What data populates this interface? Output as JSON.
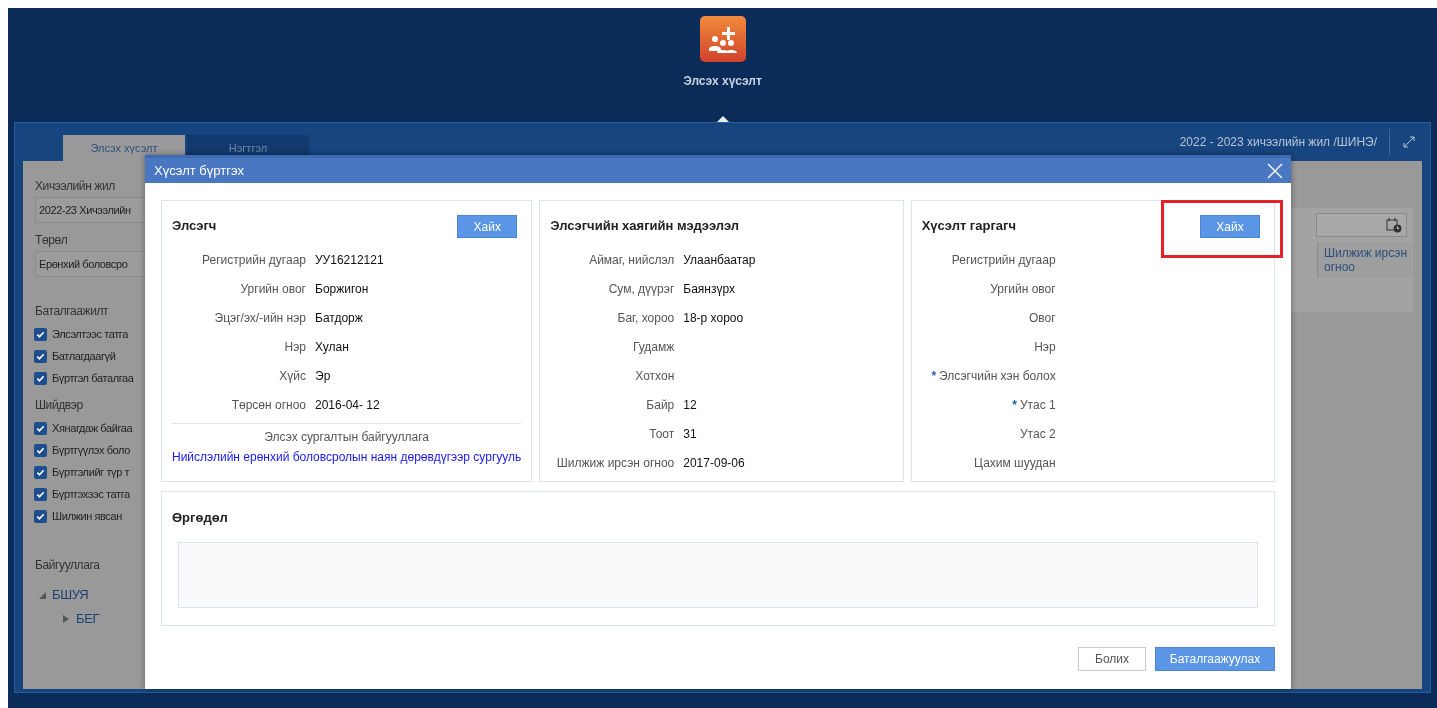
{
  "app": {
    "title": "Элсэх хүсэлт"
  },
  "panel": {
    "tabs": [
      {
        "label": "Элсэх хүсэлт",
        "selected": true
      },
      {
        "label": "Нэгтгэл",
        "selected": false
      }
    ],
    "year": "2022 - 2023 хичээлийн жил /ШИНЭ/"
  },
  "sidebar": {
    "fields": [
      {
        "label": "Хичээлийн жил",
        "value": "2022-23 Хичээлийн"
      },
      {
        "label": "Төрөл",
        "value": "Ерөнхий боловсро"
      }
    ],
    "groups": [
      {
        "title": "Баталгаажилт",
        "items": [
          {
            "label": "Элсэлтээс татга",
            "checked": true
          },
          {
            "label": "Батлагдаагүй",
            "checked": true
          },
          {
            "label": "Бүртгэл баталгаа",
            "checked": true
          }
        ]
      },
      {
        "title": "Шийдвэр",
        "items": [
          {
            "label": "Хянагдаж байгаа",
            "checked": true
          },
          {
            "label": "Бүртгүүлэх боло",
            "checked": true
          },
          {
            "label": "Бүртгэлийг түр т",
            "checked": true
          },
          {
            "label": "Бүртгэхээс татга",
            "checked": true
          },
          {
            "label": "Шилжин явсан",
            "checked": true
          }
        ]
      }
    ],
    "org": {
      "title": "Байгууллага",
      "tree": [
        {
          "label": "БШУЯ",
          "expanded": true,
          "children": [
            {
              "label": "БЕГ",
              "expanded": false
            }
          ]
        }
      ]
    }
  },
  "table": {
    "columns": [
      "Шилжиж ирсэн огноо"
    ]
  },
  "dialog": {
    "title": "Хүсэлт бүртгэх",
    "sections": [
      {
        "title": "Элсэгч",
        "button": {
          "label": "Хайх",
          "highlighted": false
        },
        "rows": [
          {
            "label": "Регистрийн дугаар",
            "value": "УУ16212121"
          },
          {
            "label": "Ургийн овог",
            "value": "Боржигон"
          },
          {
            "label": "Эцэг/эх/-ийн нэр",
            "value": "Батдорж"
          },
          {
            "label": "Нэр",
            "value": "Хулан"
          },
          {
            "label": "Хүйс",
            "value": "Эр"
          },
          {
            "label": "Төрсөн огноо",
            "value": "2016-04- 12"
          }
        ],
        "org_label": "Элсэх сургалтын байгууллага",
        "org_value": "Нийслэлийн ерөнхий боловсролын наян дөрөвдүгээр сургууль"
      },
      {
        "title": "Элсэгчийн хаягийн мэдээлэл",
        "rows": [
          {
            "label": "Аймаг, нийслэл",
            "value": "Улаанбаатар"
          },
          {
            "label": "Сум, дүүрэг",
            "value": "Баянзүрх"
          },
          {
            "label": "Баг, хороо",
            "value": "18-р хороо"
          },
          {
            "label": "Гудамж"
          },
          {
            "label": "Хотхон"
          },
          {
            "label": "Байр",
            "value": "12"
          },
          {
            "label": "Тоот",
            "value": "31"
          },
          {
            "label": "Шилжиж ирсэн огноо",
            "value": "2017-09-06"
          }
        ]
      },
      {
        "title": "Хүсэлт гаргагч",
        "button": {
          "label": "Хайх",
          "highlighted": true
        },
        "rows": [
          {
            "label": "Регистрийн дугаар"
          },
          {
            "label": "Ургийн овог"
          },
          {
            "label": "Овог"
          },
          {
            "label": "Нэр"
          },
          {
            "label": "Элсэгчийн хэн болох",
            "marker": "*"
          },
          {
            "label": "Утас 1",
            "marker": "*"
          },
          {
            "label": "Утас 2"
          },
          {
            "label": "Цахим шуудан"
          }
        ]
      }
    ],
    "application": {
      "title": "Өргөдөл"
    },
    "buttons": [
      {
        "label": "Болих",
        "kind": "secondary"
      },
      {
        "label": "Баталгаажуулах",
        "kind": "primary"
      }
    ]
  }
}
